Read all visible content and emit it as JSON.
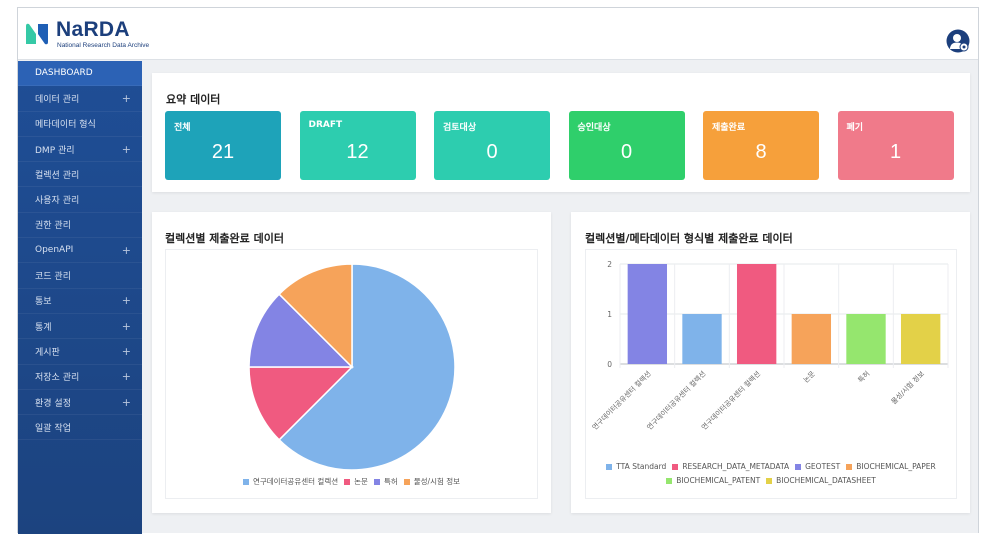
{
  "header": {
    "logo_name": "NaRDA",
    "logo_sub": "National Research Data Archive",
    "brand_color": "#1c3f7c",
    "logo_colors": [
      "#35c9a6",
      "#1f5fb5"
    ]
  },
  "sidebar": {
    "items": [
      {
        "label": "DASHBOARD",
        "expandable": false,
        "active": true
      },
      {
        "label": "데이터 관리",
        "expandable": true
      },
      {
        "label": "메타데이터 형식",
        "expandable": false
      },
      {
        "label": "DMP 관리",
        "expandable": true
      },
      {
        "label": "컬렉션 관리",
        "expandable": false
      },
      {
        "label": "사용자 관리",
        "expandable": false
      },
      {
        "label": "권한 관리",
        "expandable": false
      },
      {
        "label": "OpenAPI",
        "expandable": true
      },
      {
        "label": "코드 관리",
        "expandable": false
      },
      {
        "label": "통보",
        "expandable": true
      },
      {
        "label": "통계",
        "expandable": true
      },
      {
        "label": "게시판",
        "expandable": true
      },
      {
        "label": "저장소 관리",
        "expandable": true
      },
      {
        "label": "환경 설정",
        "expandable": true
      },
      {
        "label": "일괄 작업",
        "expandable": false
      }
    ],
    "plus_glyph": "+"
  },
  "summary": {
    "title": "요약 데이터",
    "tiles": [
      {
        "label": "전체",
        "value": "21",
        "color": "#1ea3b9"
      },
      {
        "label": "DRAFT",
        "value": "12",
        "color": "#2dcdaf"
      },
      {
        "label": "검토대상",
        "value": "0",
        "color": "#2dcdaf"
      },
      {
        "label": "승인대상",
        "value": "0",
        "color": "#2fcf6b"
      },
      {
        "label": "제출완료",
        "value": "8",
        "color": "#f6a03b"
      },
      {
        "label": "폐기",
        "value": "1",
        "color": "#f07a8a"
      }
    ]
  },
  "pie_panel": {
    "title": "컬렉션별 제출완료 데이터"
  },
  "bar_panel": {
    "title": "컬렉션별/메타데이터 형식별 제출완료 데이터"
  },
  "chart_data": [
    {
      "type": "pie",
      "title": "컬렉션별 제출완료 데이터",
      "slices": [
        {
          "label": "연구데이터공유센터 컬렉션",
          "value": 5,
          "color": "#7fb3ea"
        },
        {
          "label": "논문",
          "value": 1,
          "color": "#f05a80"
        },
        {
          "label": "특허",
          "value": 1,
          "color": "#8384e4"
        },
        {
          "label": "물성/시험 정보",
          "value": 1,
          "color": "#f6a35a"
        }
      ],
      "legend": "bottom"
    },
    {
      "type": "bar",
      "title": "컬렉션별/메타데이터 형식별 제출완료 데이터",
      "categories": [
        "연구데이터공유센터 컬렉션",
        "연구데이터공유센터 컬렉션",
        "연구데이터공유센터 컬렉션",
        "논문",
        "특허",
        "물성/시험 정보"
      ],
      "values": [
        2,
        1,
        2,
        1,
        1,
        1
      ],
      "bar_colors": [
        "#8384e4",
        "#7fb3ea",
        "#f05a80",
        "#f6a35a",
        "#95e66e",
        "#e3d148"
      ],
      "ylim": [
        0,
        2
      ],
      "yticks": [
        "0",
        "1",
        "2"
      ],
      "grid": true,
      "legend": "bottom",
      "legend_items": [
        {
          "label": "TTA Standard",
          "color": "#7fb3ea"
        },
        {
          "label": "RESEARCH_DATA_METADATA",
          "color": "#f05a80"
        },
        {
          "label": "GEOTEST",
          "color": "#8384e4"
        },
        {
          "label": "BIOCHEMICAL_PAPER",
          "color": "#f6a35a"
        },
        {
          "label": "BIOCHEMICAL_PATENT",
          "color": "#95e66e"
        },
        {
          "label": "BIOCHEMICAL_DATASHEET",
          "color": "#e3d148"
        }
      ]
    }
  ]
}
